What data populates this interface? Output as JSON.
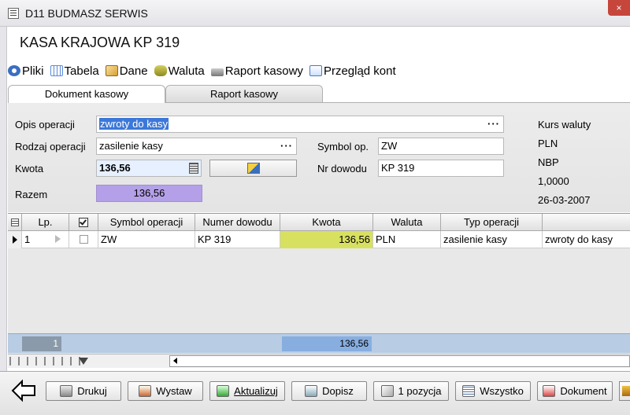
{
  "window": {
    "title": "D11 BUDMASZ SERWIS",
    "close": "×"
  },
  "heading": "KASA KRAJOWA KP 319",
  "menu": [
    {
      "label": "Pliki",
      "icon": "files-icon",
      "color": "#3a6fc0"
    },
    {
      "label": "Tabela",
      "icon": "table-icon",
      "color": "#5a8ad8"
    },
    {
      "label": "Dane",
      "icon": "data-icon",
      "color": "#d8a030"
    },
    {
      "label": "Waluta",
      "icon": "currency-icon",
      "color": "#8a8a20"
    },
    {
      "label": "Raport kasowy",
      "icon": "cash-report-icon",
      "color": "#777777"
    },
    {
      "label": "Przegląd kont",
      "icon": "accounts-icon",
      "color": "#4a78c8"
    }
  ],
  "tabs": [
    {
      "label": "Dokument kasowy"
    },
    {
      "label": "Raport kasowy"
    }
  ],
  "form": {
    "opis_label": "Opis operacji",
    "opis_value": "zwroty do kasy",
    "rodzaj_label": "Rodzaj operacji",
    "rodzaj_value": "zasilenie kasy",
    "kwota_label": "Kwota",
    "kwota_value": "136,56",
    "razem_label": "Razem",
    "razem_value": "136,56",
    "symbol_label": "Symbol op.",
    "symbol_value": "ZW",
    "nr_label": "Nr dowodu",
    "nr_value": "KP 319",
    "dots": "···"
  },
  "rate": {
    "label": "Kurs waluty",
    "currency": "PLN",
    "source": "NBP",
    "value": "1,0000",
    "date": "26-03-2007"
  },
  "grid": {
    "headers": [
      "Lp.",
      "Symbol operacji",
      "Numer dowodu",
      "Kwota",
      "Waluta",
      "Typ operacji"
    ],
    "row": {
      "lp": "1",
      "symbol": "ZW",
      "numer": "KP 319",
      "kwota": "136,56",
      "waluta": "PLN",
      "typ": "zasilenie kasy",
      "opis": "zwroty do kasy"
    },
    "footer": {
      "count": "1",
      "sum": "136,56"
    }
  },
  "buttons": {
    "drukuj": "Drukuj",
    "wystaw": "Wystaw",
    "aktualizuj": "Aktualizuj",
    "dopisz": "Dopisz",
    "pozycja": "1 pozycja",
    "wszystko": "Wszystko",
    "dokument": "Dokument"
  },
  "colors": {
    "selection": "#3c78d8",
    "razem_fill": "#b4a0e8",
    "kwota_cell": "#d8e060",
    "footer": "#b8cce4",
    "kwota_input": "#e6f0ff"
  }
}
